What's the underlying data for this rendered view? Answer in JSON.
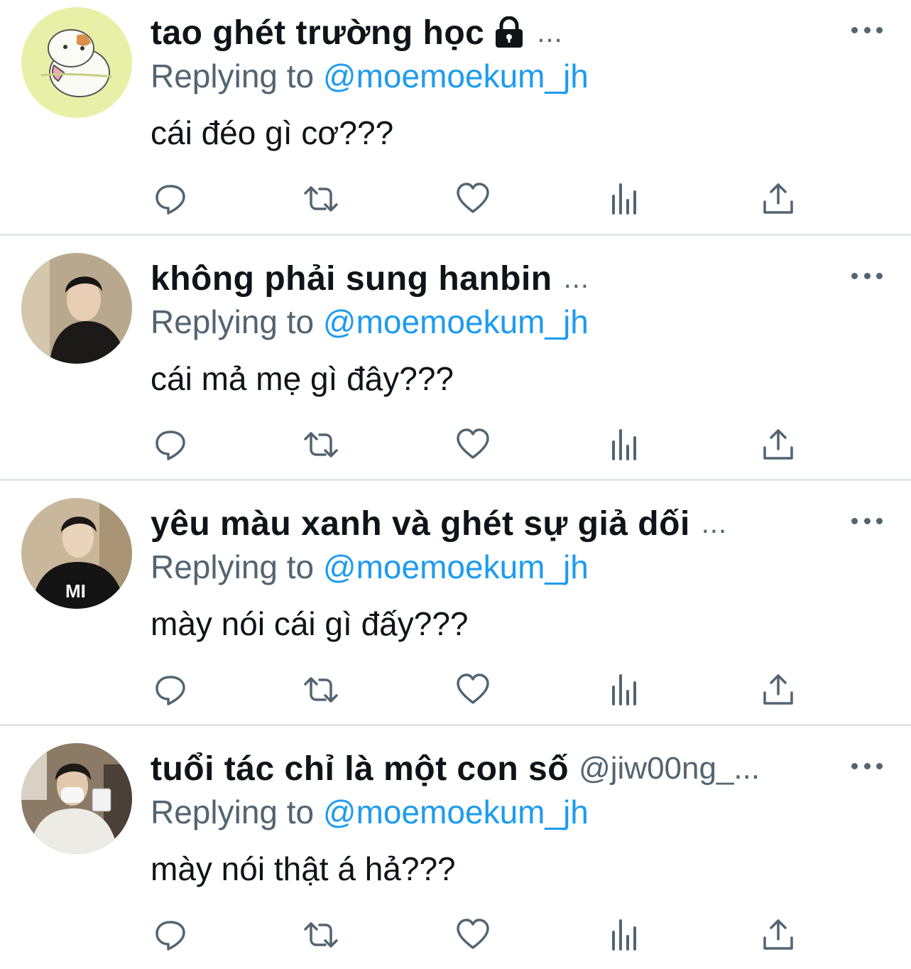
{
  "tweets": [
    {
      "name": "tao ghét trường học",
      "handle": "",
      "locked": true,
      "trail": "...",
      "replying_label": "Replying to",
      "replying_to": "@moemoekum_jh",
      "text": "cái đéo gì cơ???",
      "avatar": "hamster-cartoon-avatar"
    },
    {
      "name": "không phải sung hanbin",
      "handle": "",
      "locked": false,
      "trail": "...",
      "replying_label": "Replying to",
      "replying_to": "@moemoekum_jh",
      "text": "cái mả mẹ gì đây???",
      "avatar": "person-photo-avatar"
    },
    {
      "name": "yêu màu xanh và ghét sự giả dối",
      "handle": "",
      "locked": false,
      "trail": "...",
      "replying_label": "Replying to",
      "replying_to": "@moemoekum_jh",
      "text": "mày nói cái gì đấy???",
      "avatar": "person-photo-avatar"
    },
    {
      "name": "tuổi tác chỉ là một con số",
      "handle": "@jiw00ng_...",
      "locked": false,
      "trail": "",
      "replying_label": "Replying to",
      "replying_to": "@moemoekum_jh",
      "text": "mày nói thật á hả???",
      "avatar": "person-photo-avatar"
    }
  ],
  "icons": {
    "reply": "reply-icon",
    "retweet": "retweet-icon",
    "like": "heart-icon",
    "views": "analytics-icon",
    "share": "share-icon",
    "more": "more-dots-icon"
  },
  "colors": {
    "text": "#0f1419",
    "muted": "#536471",
    "link": "#1d9bf0",
    "divider": "#e1e6ea"
  }
}
